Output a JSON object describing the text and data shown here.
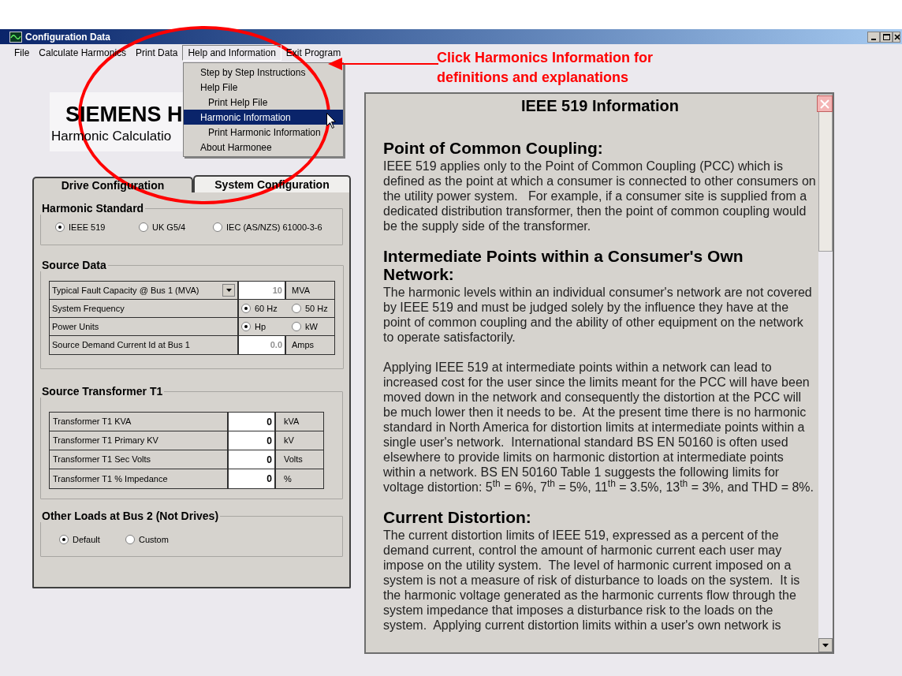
{
  "window": {
    "title": "Configuration Data"
  },
  "menu_bar": [
    {
      "label": "File",
      "open": false
    },
    {
      "label": "Calculate Harmonics",
      "open": false
    },
    {
      "label": "Print Data",
      "open": false
    },
    {
      "label": "Help and Information",
      "open": true
    },
    {
      "label": "Exit Program",
      "open": false
    }
  ],
  "dropdown": [
    {
      "label": "Step  by Step Instructions",
      "selected": false
    },
    {
      "label": "Help File",
      "selected": false,
      "children": [
        {
          "label": "Print Help File",
          "selected": false
        }
      ]
    },
    {
      "label": "Harmonic Information",
      "selected": true,
      "children": [
        {
          "label": "Print Harmonic Information",
          "selected": false
        }
      ]
    },
    {
      "label": "About Harmonee",
      "selected": false
    }
  ],
  "callout": {
    "text": "Click Harmonics Information for\ndefinitions and explanations"
  },
  "logo": {
    "title": "SIEMENS H",
    "subtitle": "Harmonic Calculatio"
  },
  "tabs": [
    {
      "label": "Drive Configuration",
      "selected": false
    },
    {
      "label": "System Configuration",
      "selected": true
    }
  ],
  "harmonic_standard": {
    "title": "Harmonic Standard",
    "options": [
      {
        "label": "IEEE 519",
        "selected": true
      },
      {
        "label": "UK G5/4",
        "selected": false
      },
      {
        "label": "IEC (AS/NZS) 61000-3-6",
        "selected": false
      }
    ]
  },
  "source_data": {
    "title": "Source Data",
    "rows": [
      {
        "kind": "dropdown",
        "label": "Typical Fault Capacity @ Bus 1 (MVA)",
        "value": "10",
        "unit": "MVA"
      },
      {
        "kind": "radio",
        "label": "System Frequency",
        "options": [
          {
            "label": "60 Hz",
            "selected": true
          },
          {
            "label": "50 Hz",
            "selected": false
          }
        ]
      },
      {
        "kind": "radio",
        "label": "Power Units",
        "options": [
          {
            "label": "Hp",
            "selected": true
          },
          {
            "label": "kW",
            "selected": false
          }
        ]
      },
      {
        "kind": "input",
        "label": "Source Demand Current Id at Bus 1",
        "value": "0.0",
        "unit": "Amps"
      }
    ]
  },
  "source_transformer": {
    "title": "Source Transformer T1",
    "rows": [
      {
        "label": "Transformer T1 KVA",
        "value": "0",
        "unit": "kVA"
      },
      {
        "label": "Transformer T1 Primary KV",
        "value": "0",
        "unit": "kV"
      },
      {
        "label": "Transformer T1 Sec Volts",
        "value": "0",
        "unit": "Volts"
      },
      {
        "label": "Transformer T1 % Impedance",
        "value": "0",
        "unit": "%"
      }
    ]
  },
  "other_loads": {
    "title": "Other Loads at Bus 2 (Not Drives)",
    "options": [
      {
        "label": "Default",
        "selected": true
      },
      {
        "label": "Custom",
        "selected": false
      }
    ]
  },
  "info_panel": {
    "title": "IEEE 519 Information",
    "sections": [
      {
        "heading": "Point of Common Coupling:",
        "paragraphs": [
          "IEEE 519 applies only to the Point of Common Coupling (PCC) which is defined as the point at which a consumer is connected to other consumers on the utility power system.   For example, if a consumer site is supplied from a dedicated distribution transformer, then the point of common coupling would be the supply side of the transformer."
        ]
      },
      {
        "heading": "Intermediate Points within a Consumer's Own Network:",
        "paragraphs": [
          "The harmonic levels within an individual consumer's network are not covered by IEEE 519 and must be judged solely by the influence they have at the point of common coupling and the ability of other equipment on the network to operate satisfactorily.",
          "Applying IEEE 519 at intermediate points within a network can lead to increased cost for the user since the limits meant for the PCC will have been moved down in the network and consequently the distortion at the PCC will be much lower then it needs to be.  At the present time there is no harmonic standard in North America for distortion limits at intermediate points within a single user's network.  International standard BS EN 50160 is often used elsewhere to provide limits on harmonic distortion at intermediate points within a network. BS EN 50160 Table 1 suggests the following limits for voltage distortion: 5$^{th}$ = 6%, 7$^{th}$ = 5%, 11$^{th}$ = 3.5%, 13$^{th}$ = 3%, and THD = 8%."
        ]
      },
      {
        "heading": "Current Distortion:",
        "paragraphs": [
          "The current distortion limits of IEEE 519, expressed as a percent of the demand current, control the amount of harmonic current each user may impose on the utility system.  The level of harmonic current imposed on a system is not a measure of risk of disturbance to loads on the system.  It is the harmonic voltage generated as the harmonic currents flow through the system impedance that imposes a disturbance risk to the loads on the system.  Applying current distortion limits within a user's own network is"
        ]
      }
    ]
  }
}
